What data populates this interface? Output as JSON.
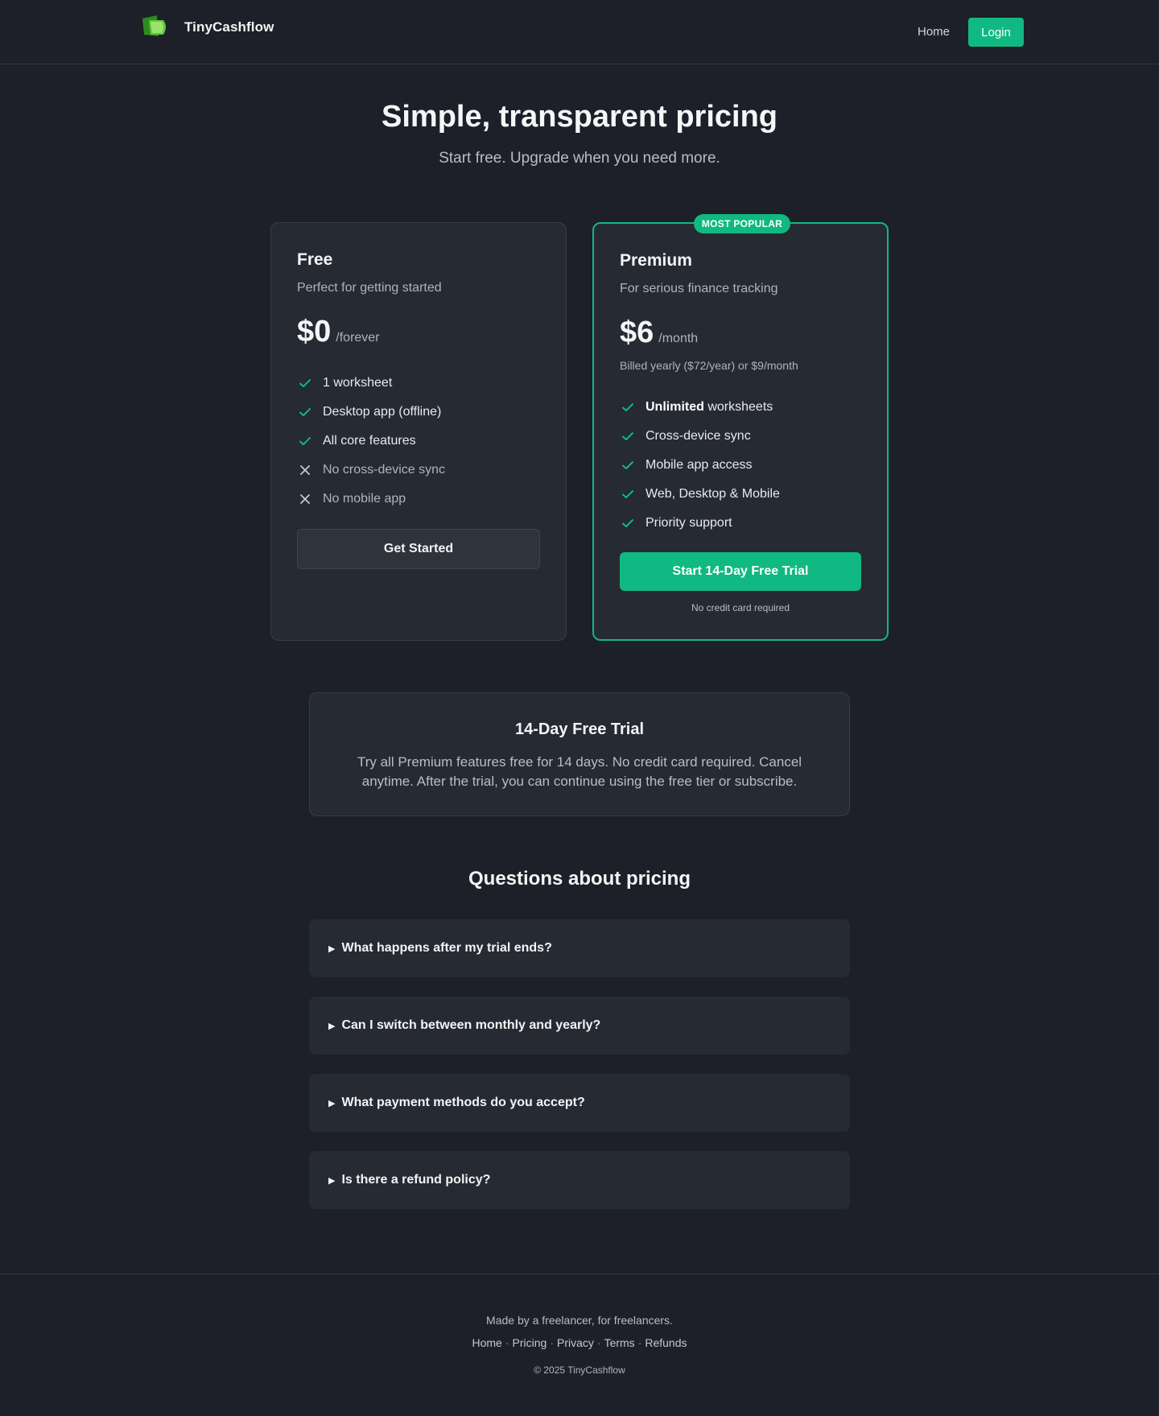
{
  "header": {
    "brand": "TinyCashflow",
    "nav_home": "Home",
    "nav_login": "Login"
  },
  "hero": {
    "title": "Simple, transparent pricing",
    "subtitle": "Start free. Upgrade when you need more."
  },
  "plans": {
    "free": {
      "name": "Free",
      "description": "Perfect for getting started",
      "price": "$0",
      "period": "/forever",
      "features": [
        {
          "text": "1 worksheet",
          "included": true
        },
        {
          "text": "Desktop app (offline)",
          "included": true
        },
        {
          "text": "All core features",
          "included": true
        },
        {
          "text": "No cross-device sync",
          "included": false
        },
        {
          "text": "No mobile app",
          "included": false
        }
      ],
      "cta": "Get Started"
    },
    "premium": {
      "badge": "MOST POPULAR",
      "name": "Premium",
      "description": "For serious finance tracking",
      "price": "$6",
      "period": "/month",
      "billing": "Billed yearly ($72/year) or $9/month",
      "features": [
        {
          "bold": "Unlimited",
          "text": " worksheets",
          "included": true
        },
        {
          "text": "Cross-device sync",
          "included": true
        },
        {
          "text": "Mobile app access",
          "included": true
        },
        {
          "text": "Web, Desktop & Mobile",
          "included": true
        },
        {
          "text": "Priority support",
          "included": true
        }
      ],
      "cta": "Start 14-Day Free Trial",
      "note": "No credit card required"
    }
  },
  "trial": {
    "title": "14-Day Free Trial",
    "text": "Try all Premium features free for 14 days. No credit card required. Cancel anytime. After the trial, you can continue using the free tier or subscribe."
  },
  "faq": {
    "title": "Questions about pricing",
    "items": [
      "What happens after my trial ends?",
      "Can I switch between monthly and yearly?",
      "What payment methods do you accept?",
      "Is there a refund policy?"
    ]
  },
  "footer": {
    "tagline": "Made by a freelancer, for freelancers.",
    "links": [
      "Home",
      "Pricing",
      "Privacy",
      "Terms",
      "Refunds"
    ],
    "separator": "·",
    "copyright": "© 2025 TinyCashflow"
  },
  "colors": {
    "accent": "#10b981",
    "background": "#1d2028",
    "card": "#262a33"
  },
  "icons": {
    "included": "check-icon",
    "excluded": "x-icon",
    "faq_toggle": "triangle-right-icon"
  }
}
